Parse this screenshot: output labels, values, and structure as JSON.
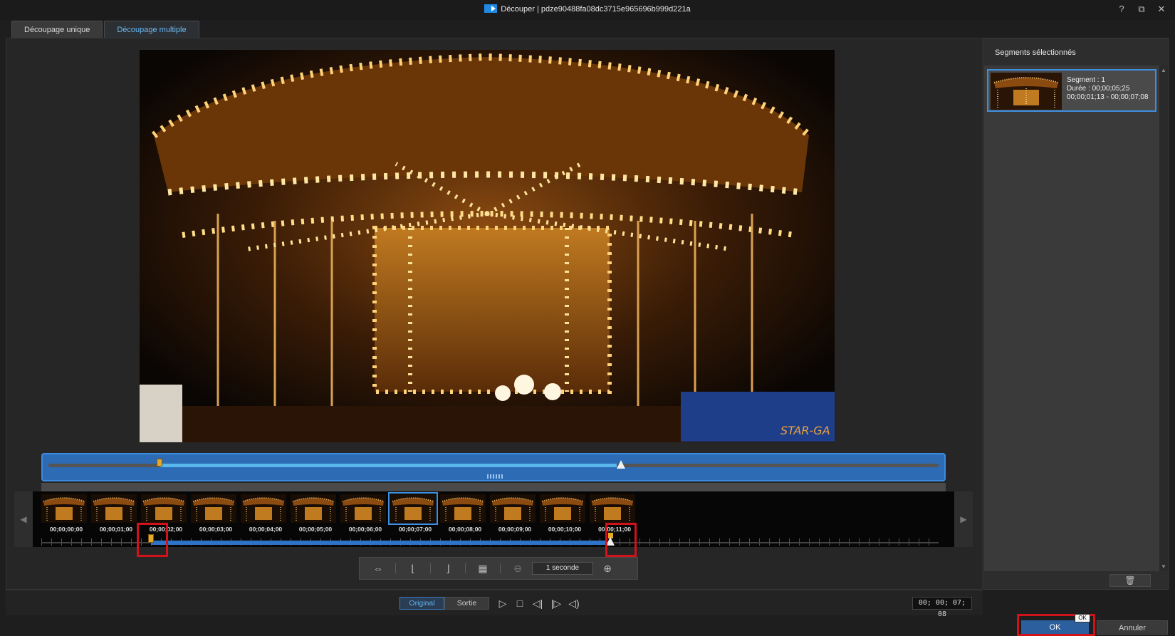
{
  "window": {
    "title": "Découper | pdze90488fa08dc3715e965696b999d221a",
    "help": "?",
    "restore": "⧉",
    "close": "✕"
  },
  "tabs": [
    {
      "label": "Découpage unique"
    },
    {
      "label": "Découpage multiple"
    }
  ],
  "timeline": {
    "labels": [
      "00;00;00;00",
      "00;00;01;00",
      "00;00;02;00",
      "00;00;03;00",
      "00;00;04;00",
      "00;00;05;00",
      "00;00;06;00",
      "00;00;07;00",
      "00;00;08;00",
      "00;00;09;00",
      "00;00;10;00",
      "00;00;11;00"
    ],
    "left_arrow": "◀",
    "right_arrow": "▶"
  },
  "toolbar": {
    "zoom_value": "1 seconde"
  },
  "playback": {
    "original_label": "Original",
    "output_label": "Sortie",
    "timecode": "00; 00; 07; 08"
  },
  "side_panel": {
    "title": "Segments sélectionnés",
    "segment": {
      "name": "Segment : 1",
      "duration": "Durée : 00;00;05;25",
      "range": "00;00;01;13 - 00;00;07;08"
    }
  },
  "footer": {
    "ok_label": "OK",
    "tooltip": "OK",
    "cancel_label": "Annuler"
  },
  "icons": [
    "app-logo-icon",
    "swap-icon",
    "mark-in-icon",
    "mark-out-icon",
    "multi-trim-icon",
    "zoom-out-icon",
    "zoom-in-icon",
    "play-icon",
    "stop-icon",
    "prev-frame-icon",
    "next-frame-icon",
    "volume-icon",
    "trash-icon"
  ],
  "colors": {
    "accent": "#3f8fe0",
    "marker": "#e8a823",
    "highlight": "#d0121b"
  }
}
